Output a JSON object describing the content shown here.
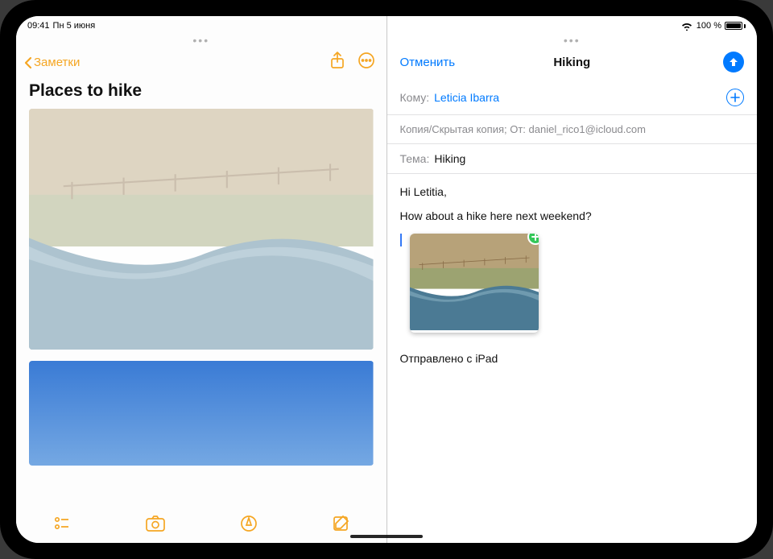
{
  "status": {
    "time": "09:41",
    "date": "Пн 5 июня",
    "battery_text": "100 %"
  },
  "notes": {
    "back_label": "Заметки",
    "title": "Places to hike"
  },
  "mail": {
    "cancel": "Отменить",
    "title": "Hiking",
    "to_label": "Кому:",
    "to_value": "Leticia Ibarra",
    "cc_line": "Копия/Скрытая копия; От: daniel_rico1@icloud.com",
    "subject_label": "Тема:",
    "subject_value": "Hiking",
    "body_greeting": "Hi Letitia,",
    "body_line": "How about a hike here next weekend?",
    "signature": "Отправлено с iPad"
  }
}
